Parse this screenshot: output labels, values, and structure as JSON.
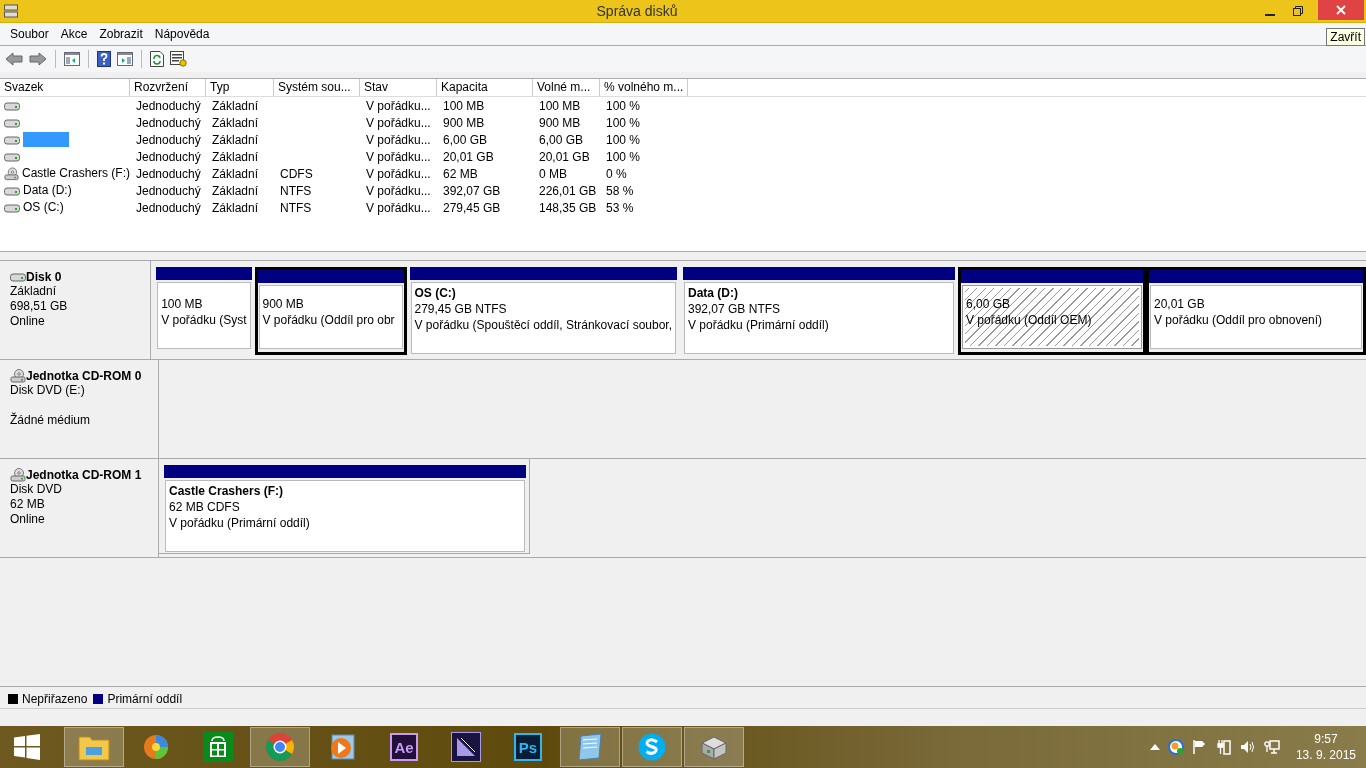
{
  "window": {
    "title": "Správa disků",
    "close_tooltip": "Zavřít"
  },
  "menu": [
    "Soubor",
    "Akce",
    "Zobrazit",
    "Nápověda"
  ],
  "toolbar": [
    {
      "kind": "back"
    },
    {
      "kind": "forward"
    },
    {
      "kind": "sep"
    },
    {
      "kind": "panel-left"
    },
    {
      "kind": "sep"
    },
    {
      "kind": "help"
    },
    {
      "kind": "panel-right"
    },
    {
      "kind": "sep"
    },
    {
      "kind": "refresh"
    },
    {
      "kind": "properties"
    }
  ],
  "volumes": {
    "columns": [
      "Svazek",
      "Rozvržení",
      "Typ",
      "Systém sou...",
      "Stav",
      "Kapacita",
      "Volné m...",
      "% volného m..."
    ],
    "rows": [
      {
        "kind": "disk",
        "selected": false,
        "cells": [
          "",
          "Jednoduchý",
          "Základní",
          "",
          "V pořádku...",
          "100 MB",
          "100 MB",
          "100 %"
        ]
      },
      {
        "kind": "disk",
        "selected": false,
        "cells": [
          "",
          "Jednoduchý",
          "Základní",
          "",
          "V pořádku...",
          "900 MB",
          "900 MB",
          "100 %"
        ]
      },
      {
        "kind": "disk",
        "selected": true,
        "cells": [
          "",
          "Jednoduchý",
          "Základní",
          "",
          "V pořádku...",
          "6,00 GB",
          "6,00 GB",
          "100 %"
        ]
      },
      {
        "kind": "disk",
        "selected": false,
        "cells": [
          "",
          "Jednoduchý",
          "Základní",
          "",
          "V pořádku...",
          "20,01 GB",
          "20,01 GB",
          "100 %"
        ]
      },
      {
        "kind": "cdrom",
        "selected": false,
        "cells": [
          "Castle Crashers (F:)",
          "Jednoduchý",
          "Základní",
          "CDFS",
          "V pořádku...",
          "62 MB",
          "0 MB",
          "0 %"
        ]
      },
      {
        "kind": "disk",
        "selected": false,
        "cells": [
          "Data (D:)",
          "Jednoduchý",
          "Základní",
          "NTFS",
          "V pořádku...",
          "392,07 GB",
          "226,01 GB",
          "58 %"
        ]
      },
      {
        "kind": "disk",
        "selected": false,
        "cells": [
          "OS (C:)",
          "Jednoduchý",
          "Základní",
          "NTFS",
          "V pořádku...",
          "279,45 GB",
          "148,35 GB",
          "53 %"
        ]
      }
    ]
  },
  "disks": [
    {
      "kind": "disk",
      "name": "Disk 0",
      "type": "Základní",
      "size": "698,51 GB",
      "status": "Online",
      "partitions": [
        {
          "size": "100 MB",
          "status": "V pořádku (Syst",
          "selected": false,
          "hatched": false
        },
        {
          "size": "900 MB",
          "status": "V pořádku (Oddíl pro obr",
          "selected": true,
          "hatched": false
        },
        {
          "title": "OS  (C:)",
          "size": "279,45 GB NTFS",
          "status": "V pořádku (Spouštěcí oddíl, Stránkovací soubor,",
          "selected": false,
          "hatched": false
        },
        {
          "title": "Data  (D:)",
          "size": "392,07 GB NTFS",
          "status": "V pořádku (Primární oddíl)",
          "selected": false,
          "hatched": false
        },
        {
          "size": "6,00 GB",
          "status": "V pořádku (Oddíl OEM)",
          "selected": true,
          "hatched": true
        },
        {
          "size": "20,01 GB",
          "status": "V pořádku (Oddíl pro obnovení)",
          "selected": true,
          "hatched": false
        }
      ]
    },
    {
      "kind": "cdrom",
      "name": "Jednotka CD-ROM 0",
      "type": "Disk DVD (E:)",
      "status": "Žádné médium"
    },
    {
      "kind": "cdrom",
      "name": "Jednotka CD-ROM 1",
      "type": "Disk DVD",
      "size": "62 MB",
      "status": "Online",
      "partitions": [
        {
          "title": "Castle Crashers  (F:)",
          "size": "62 MB CDFS",
          "status": "V pořádku (Primární oddíl)",
          "selected": false,
          "hatched": false
        }
      ]
    }
  ],
  "legend": [
    {
      "label": "Nepřiřazeno",
      "color": "#000000"
    },
    {
      "label": "Primární oddíl",
      "color": "#000080"
    }
  ],
  "taskbar": {
    "apps": [
      {
        "kind": "explorer",
        "active": true
      },
      {
        "kind": "globe",
        "active": false
      },
      {
        "kind": "store",
        "active": false
      },
      {
        "kind": "chrome",
        "active": true
      },
      {
        "kind": "player",
        "active": false
      },
      {
        "kind": "ae",
        "label": "Ae",
        "active": false
      },
      {
        "kind": "premiere",
        "active": false
      },
      {
        "kind": "ps",
        "label": "Ps",
        "active": false
      },
      {
        "kind": "notepad",
        "active": true
      },
      {
        "kind": "skype",
        "active": true
      },
      {
        "kind": "diskmgmt",
        "active": true
      }
    ],
    "time": "9:57",
    "date": "13. 9. 2015"
  }
}
